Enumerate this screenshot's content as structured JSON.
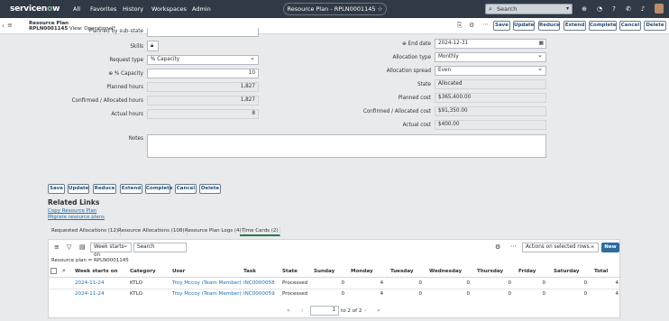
{
  "topbar": {
    "logo": "servicenow",
    "nav": [
      "All",
      "Favorites",
      "History",
      "Workspaces",
      "Admin"
    ],
    "record_pill": "Resource Plan - RPLN0001145",
    "search_placeholder": "Search"
  },
  "header": {
    "line1": "Resource Plan",
    "record_number": "RPLN0001145",
    "view_label": "View: Operational*"
  },
  "actions": [
    "Save",
    "Update",
    "Reduce",
    "Extend",
    "Complete",
    "Cancel",
    "Delete"
  ],
  "form": {
    "left": {
      "planned_by_sub_label": "Planned by sub-state",
      "skills_label": "Skills",
      "request_type_label": "Request type",
      "request_type_value": "% Capacity",
      "capacity_label": "% Capacity",
      "capacity_value": "10",
      "planned_hours_label": "Planned hours",
      "planned_hours_value": "1,827",
      "confirmed_hours_label": "Confirmed / Allocated hours",
      "confirmed_hours_value": "1,827",
      "actual_hours_label": "Actual hours",
      "actual_hours_value": "8"
    },
    "right": {
      "end_date_label": "End date",
      "end_date_value": "2024-12-31",
      "allocation_type_label": "Allocation type",
      "allocation_type_value": "Monthly",
      "allocation_spread_label": "Allocation spread",
      "allocation_spread_value": "Even",
      "state_label": "State",
      "state_value": "Allocated",
      "planned_cost_label": "Planned cost",
      "planned_cost_value": "$365,400.00",
      "confirmed_cost_label": "Confirmed / Allocated cost",
      "confirmed_cost_value": "$91,350.00",
      "actual_cost_label": "Actual cost",
      "actual_cost_value": "$400.00"
    },
    "notes_label": "Notes"
  },
  "bottom_actions": [
    "Save",
    "Update",
    "Reduce",
    "Extend",
    "Complete",
    "Cancel",
    "Delete"
  ],
  "related": {
    "title": "Related Links",
    "links": [
      "Copy Resource Plan",
      "Migrate resource plans"
    ]
  },
  "tabs": [
    "Requested Allocations (12)",
    "Resource Allocations (108)",
    "Resource Plan Logs (4)",
    "Time Cards (2)"
  ],
  "list": {
    "group_select": "Week starts on",
    "search_placeholder": "Search",
    "actions_select": "Actions on selected rows...",
    "new_button": "New",
    "breadcrumb": "Resource plan = RPLN0001145",
    "columns": [
      "Week starts on",
      "Category",
      "User",
      "Task",
      "State",
      "Sunday",
      "Monday",
      "Tuesday",
      "Wednesday",
      "Thursday",
      "Friday",
      "Saturday",
      "Total"
    ],
    "rows": [
      [
        "2024-11-24",
        "KTLO",
        "Troy Mccoy (Team Member)",
        "INC0000058",
        "Processed",
        "0",
        "4",
        "0",
        "0",
        "0",
        "0",
        "0",
        "4"
      ],
      [
        "2024-11-24",
        "KTLO",
        "Troy Mccoy (Team Member)",
        "INC0000059",
        "Processed",
        "0",
        "4",
        "0",
        "0",
        "0",
        "0",
        "0",
        "4"
      ]
    ],
    "pagination": {
      "current": "1",
      "text": "to 2 of 2"
    }
  }
}
